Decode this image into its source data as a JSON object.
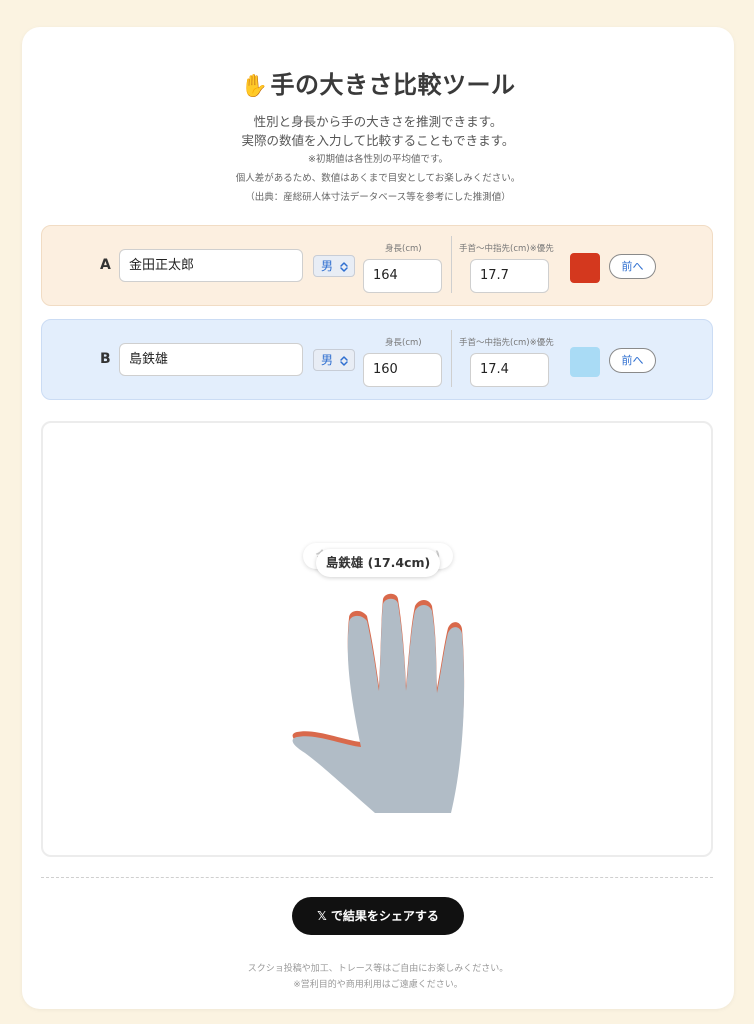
{
  "header": {
    "icon": "raised-hand-icon",
    "icon_glyph": "✋",
    "title": "手の大きさ比較ツール",
    "desc_line1": "性別と身長から手の大きさを推測できます。",
    "desc_line2": "実際の数値を入力して比較することもできます。",
    "note1": "※初期値は各性別の平均値です。",
    "note2": "個人差があるため、数値はあくまで目安としてお楽しみください。",
    "note3": "（出典：産総研人体寸法データベース等を参考にした推測値）"
  },
  "rowA": {
    "label": "A",
    "name": "金田正太郎",
    "gender": "男",
    "height_label": "身長(cm)",
    "height": "164",
    "length_label": "手首〜中指先(cm)※優先",
    "length": "17.7",
    "color": "#d4381e",
    "front_button": "前へ"
  },
  "rowB": {
    "label": "B",
    "name": "島鉄雄",
    "gender": "男",
    "height_label": "身長(cm)",
    "height": "160",
    "length_label": "手首〜中指先(cm)※優先",
    "length": "17.4",
    "color": "#a9dbf5",
    "front_button": "前へ"
  },
  "canvas": {
    "label_back": "金田正太郎 (17.7cm)",
    "label_front": "島鉄雄 (17.4cm)",
    "hand_fill": "#b1bcc6",
    "hand_back_color": "#d9694b"
  },
  "footer": {
    "share_icon": "x-logo-icon",
    "share_glyph": "𝕏",
    "share_label": "で結果をシェアする",
    "line1": "スクショ投稿や加工、トレース等はご自由にお楽しみください。",
    "line2": "※営利目的や商用利用はご遠慮ください。"
  }
}
